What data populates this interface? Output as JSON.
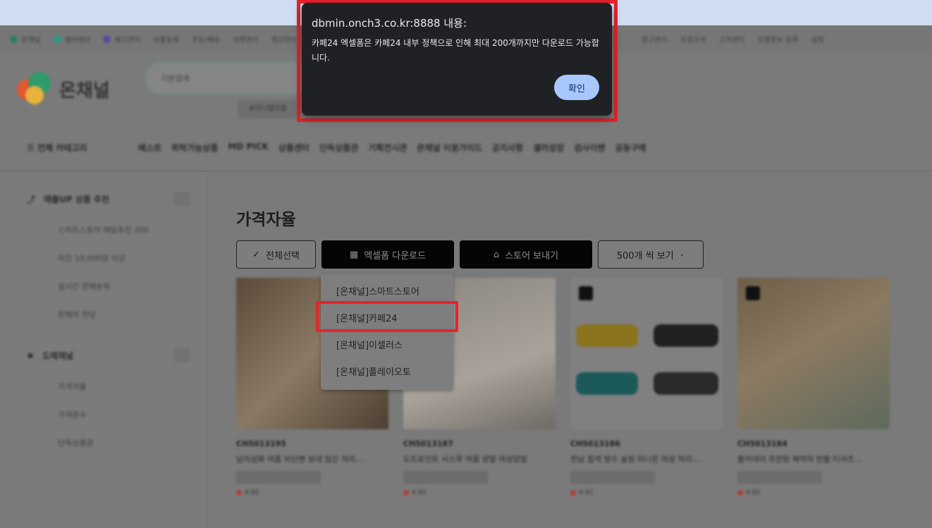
{
  "dialog": {
    "title": "dbmin.onch3.co.kr:8888 내용:",
    "message": "카페24 엑셀폼은 카페24 내부 정책으로 인해 최대 200개까지만 다운로드 가능합니다.",
    "ok_label": "확인",
    "ok_color": "#a8c7fa",
    "background": "#202124",
    "highlight_color": "#e8232b"
  },
  "page": {
    "section_title": "가격자율",
    "toolbar": {
      "select_all": "전체선택",
      "excel_download": "엑셀폼 다운로드",
      "store_send": "스토어 보내기",
      "per_page": "500개 씩 보기"
    },
    "dropdown": {
      "items": [
        "[온채널]스마트스토어",
        "[온채널]카페24",
        "[온채널]이셀러스",
        "[온채널]플레이오토"
      ],
      "highlighted_index": 1
    },
    "header": {
      "logo_text": "온채널",
      "search_option": "기본검색",
      "search_chip": "#미니멀리즘",
      "all_categories": "전체 카테고리",
      "nav": [
        "베스트",
        "위탁가능상품",
        "MD PICK",
        "상품센터",
        "단독상품관",
        "기획전시관",
        "온채널 이용가이드",
        "공지사항",
        "셀러성장",
        "검사이벤",
        "공동구매"
      ]
    },
    "bookmarks": [
      "온채널",
      "셀러센터",
      "재고관리",
      "상품등록",
      "주문/배송",
      "마켓관리",
      "정산관리",
      "광고관리",
      "프로모션",
      "고객센터",
      "상품정보 등록",
      "설정"
    ],
    "sidebar": {
      "sections": [
        {
          "title": "매출UP 상품 추천",
          "items": [
            "스마트스토어 매입추천 200",
            "마진 10,000원 이상",
            "실시간 판매순위",
            "판매자 전당"
          ]
        },
        {
          "title": "도매채널",
          "items": [
            "가격자율",
            "가격준수",
            "단독상품관"
          ]
        }
      ]
    },
    "products": [
      {
        "code": "CH5013195",
        "name": "남자삼화 여름 비단밴 보네 집신 자라…",
        "badge": "4.92"
      },
      {
        "code": "CH5013187",
        "name": "도트포인트 시스루 여름 양말 여성양말",
        "badge": "4.92"
      },
      {
        "code": "CH5013186",
        "name": "전남 힙색 방수 슬링 미니몬 여성 허리…",
        "badge": "4.92"
      },
      {
        "code": "CH5013184",
        "name": "블카네이 프린팅 해먹의 반팔 티셔츠…",
        "badge": "4.92"
      }
    ]
  }
}
